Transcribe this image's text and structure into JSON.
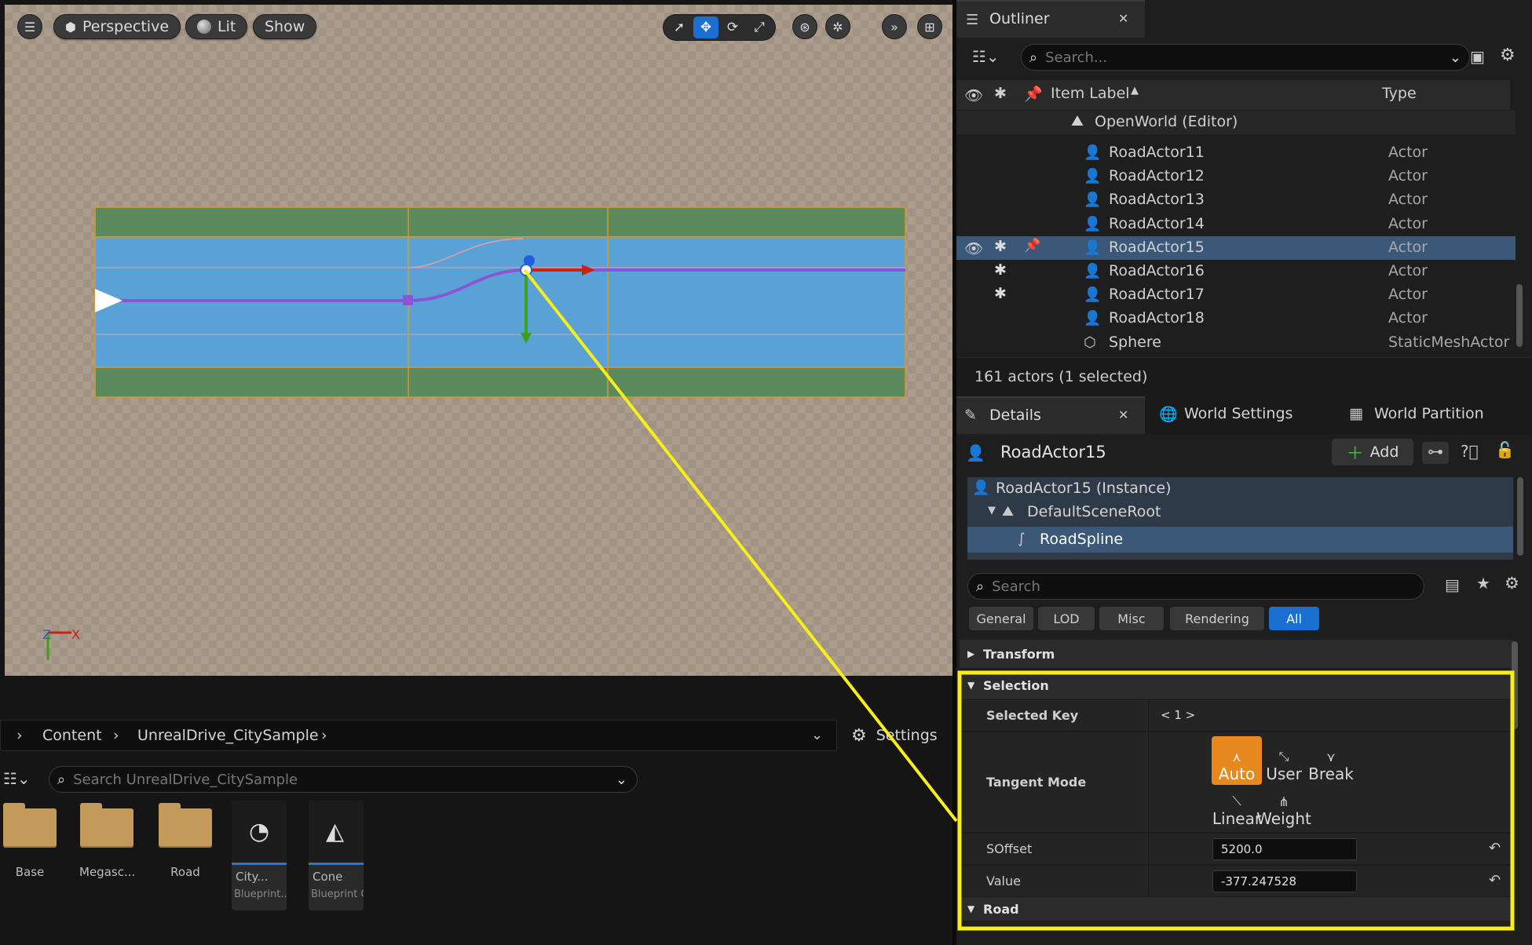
{
  "viewport": {
    "mode_label": "Perspective",
    "lighting_label": "Lit",
    "show_label": "Show",
    "axis_z": "Z",
    "axis_x": "X"
  },
  "outliner": {
    "title": "Outliner",
    "search_placeholder": "Search...",
    "col_label": "Item Label",
    "col_type": "Type",
    "world_label": "OpenWorld (Editor)",
    "rows": [
      {
        "label": "RoadActor11",
        "type": "Actor",
        "selected": false,
        "starred": false
      },
      {
        "label": "RoadActor12",
        "type": "Actor",
        "selected": false,
        "starred": false
      },
      {
        "label": "RoadActor13",
        "type": "Actor",
        "selected": false,
        "starred": false
      },
      {
        "label": "RoadActor14",
        "type": "Actor",
        "selected": false,
        "starred": false
      },
      {
        "label": "RoadActor15",
        "type": "Actor",
        "selected": true,
        "starred": true
      },
      {
        "label": "RoadActor16",
        "type": "Actor",
        "selected": false,
        "starred": true
      },
      {
        "label": "RoadActor17",
        "type": "Actor",
        "selected": false,
        "starred": true
      },
      {
        "label": "RoadActor18",
        "type": "Actor",
        "selected": false,
        "starred": false
      },
      {
        "label": "Sphere",
        "type": "StaticMeshActor",
        "selected": false,
        "starred": false
      }
    ],
    "status": "161 actors (1 selected)"
  },
  "details": {
    "tab_details": "Details",
    "tab_world_settings": "World Settings",
    "tab_world_partition": "World Partition",
    "actor_name": "RoadActor15",
    "add_label": "Add",
    "components": {
      "instance": "RoadActor15 (Instance)",
      "root": "DefaultSceneRoot",
      "spline": "RoadSpline"
    },
    "search_placeholder": "Search",
    "categories": [
      "General",
      "LOD",
      "Misc",
      "Rendering",
      "All"
    ],
    "active_category": "All",
    "sections": {
      "transform": "Transform",
      "selection": "Selection",
      "road": "Road"
    },
    "props": {
      "selected_key_label": "Selected Key",
      "selected_key_value": "< 1 >",
      "tangent_mode_label": "Tangent Mode",
      "tangent_modes": [
        "Auto",
        "User",
        "Break",
        "Linear",
        "Weight"
      ],
      "active_tangent": "Auto",
      "soffset_label": "SOffset",
      "soffset_value": "5200.0",
      "value_label": "Value",
      "value_value": "-377.247528"
    }
  },
  "content_browser": {
    "path": [
      "Content",
      "UnrealDrive_CitySample"
    ],
    "settings_label": "Settings",
    "search_placeholder": "Search UnrealDrive_CitySample",
    "folders": [
      "Base",
      "Megasc...",
      "Road"
    ],
    "assets": [
      {
        "name": "City...",
        "kind": "Blueprint..."
      },
      {
        "name": "Cone",
        "kind": "Blueprint C..."
      }
    ]
  },
  "colors": {
    "selection_blue": "#3b5878",
    "accent_blue": "#1a6fd1",
    "tangent_active": "#e8891f",
    "highlight_yellow": "#f7ee1a"
  }
}
